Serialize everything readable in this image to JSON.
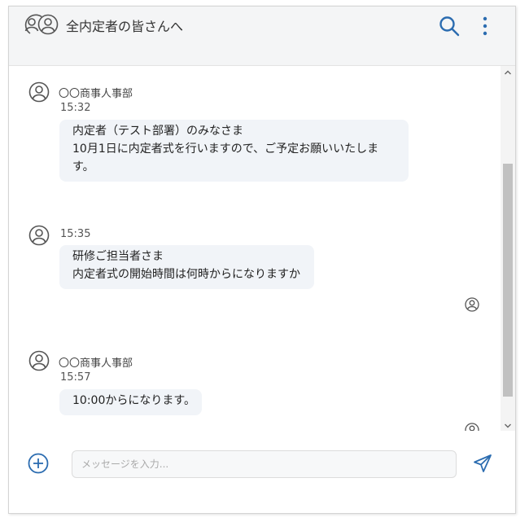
{
  "header": {
    "title": "全内定者の皆さんへ",
    "icons": {
      "group": "group-icon",
      "search": "search-icon",
      "more": "more-vertical-icon"
    }
  },
  "messages": [
    {
      "sender": "〇〇商事人事部",
      "time": "15:32",
      "lines": [
        "内定者（テスト部署）のみなさま",
        "10月1日に内定者式を行いますので、ご予定お願いいたしま",
        "す。"
      ]
    },
    {
      "sender": "",
      "time": "15:35",
      "lines": [
        "研修ご担当者さま",
        "内定者式の開始時間は何時からになりますか"
      ],
      "read": true
    },
    {
      "sender": "〇〇商事人事部",
      "time": "15:57",
      "lines": [
        "10:00からになります。"
      ],
      "read": true
    }
  ],
  "composer": {
    "placeholder": "メッセージを入力...",
    "value": "",
    "icons": {
      "add": "plus-circle-icon",
      "send": "send-icon"
    }
  },
  "colors": {
    "accent": "#2b6cb0",
    "icon_gray": "#555555",
    "bubble": "#f1f4f8",
    "header_bg": "#f4f5f6"
  }
}
